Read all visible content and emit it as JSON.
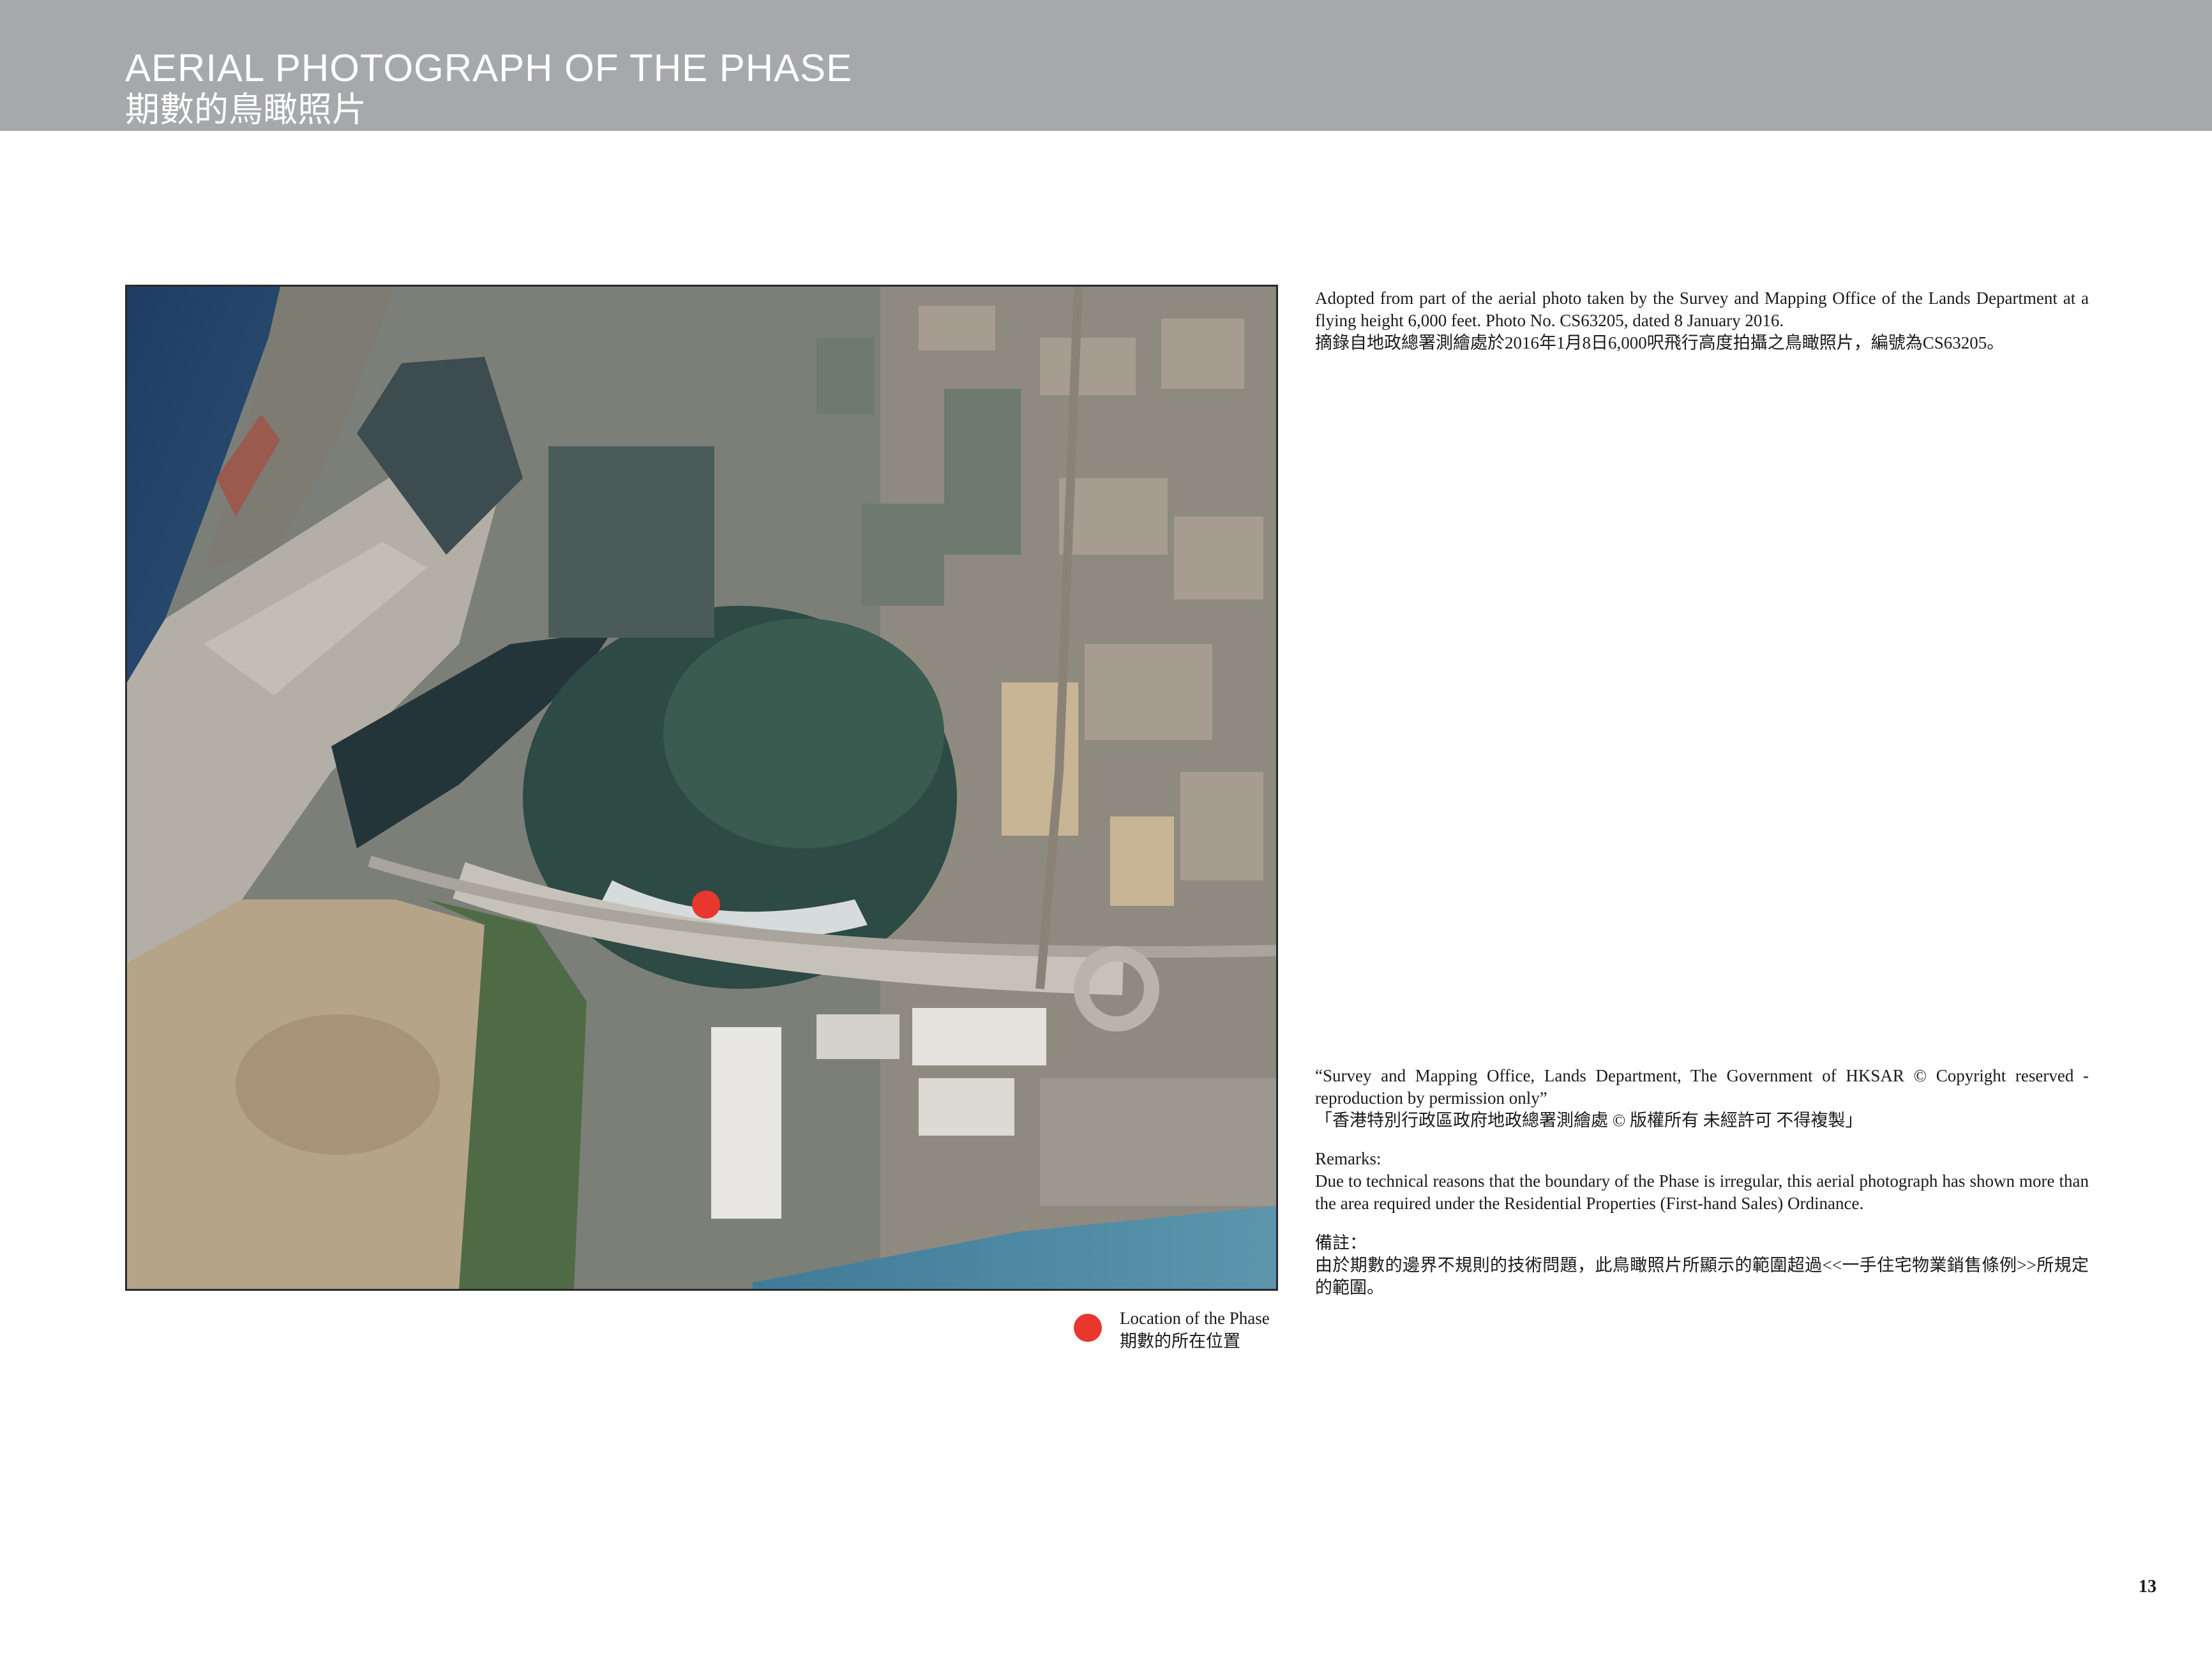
{
  "header": {
    "title_en": "AERIAL PHOTOGRAPH OF THE PHASE",
    "title_zh": "期數的鳥瞰照片"
  },
  "credit": {
    "en": "Adopted from part of the aerial photo taken by the Survey and Mapping Office of the Lands Department at a flying height 6,000 feet. Photo No. CS63205, dated 8 January 2016.",
    "zh": "摘錄自地政總署測繪處於2016年1月8日6,000呎飛行高度拍攝之鳥瞰照片，編號為CS63205。"
  },
  "copyright": {
    "en": "“Survey and Mapping Office, Lands Department, The Government of HKSAR © Copyright reserved - reproduction by permission only”",
    "zh": "「香港特別行政區政府地政總署測繪處 © 版權所有 未經許可 不得複製」"
  },
  "remarks": {
    "heading_en": "Remarks:",
    "text_en": "Due to technical reasons that the boundary of the Phase is irregular, this aerial photograph has shown more than the area required under the Residential Properties (First-hand Sales) Ordinance.",
    "heading_zh": "備註：",
    "text_zh": "由於期數的邊界不規則的技術問題，此鳥瞰照片所顯示的範圍超過<<一手住宅物業銷售條例>>所規定的範圍。"
  },
  "legend": {
    "label_en": "Location of the Phase",
    "label_zh": "期數的所在位置",
    "marker_color": "#e8372c"
  },
  "page_number": "13"
}
